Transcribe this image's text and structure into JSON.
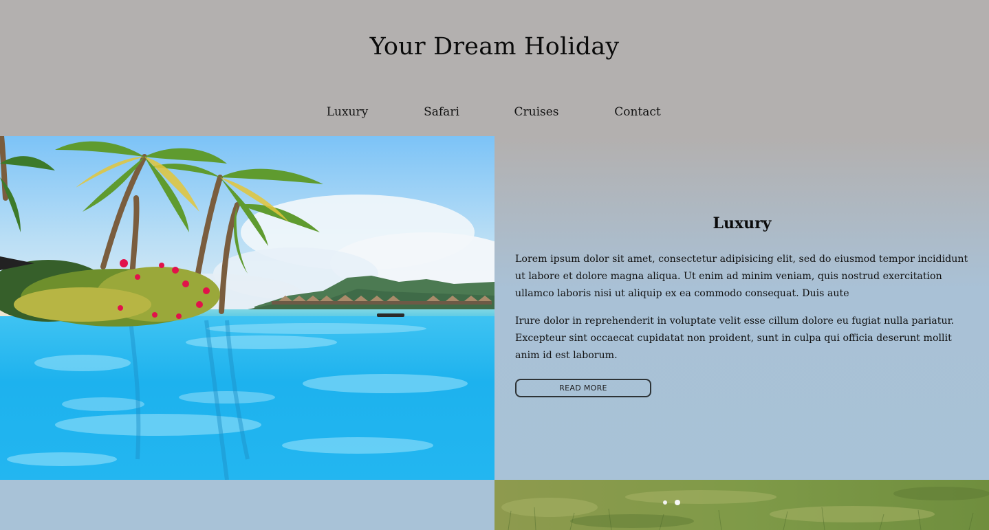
{
  "site": {
    "title": "Your Dream Holiday"
  },
  "nav": {
    "items": [
      {
        "label": "Luxury"
      },
      {
        "label": "Safari"
      },
      {
        "label": "Cruises"
      },
      {
        "label": "Contact"
      }
    ]
  },
  "feature": {
    "heading": "Luxury",
    "paragraphs": [
      "Lorem ipsum dolor sit amet, consectetur adipisicing elit, sed do eiusmod tempor incididunt ut labore et dolore magna aliqua. Ut enim ad minim veniam, quis nostrud exercitation ullamco laboris nisi ut aliquip ex ea commodo consequat. Duis aute",
      "Irure dolor in reprehenderit in voluptate velit esse cillum dolore eu fugiat nulla pariatur. Excepteur sint occaecat cupidatat non proident, sunt in culpa qui officia deserunt mollit anim id est laborum."
    ],
    "button_label": "READ MORE",
    "image_icon": "tropical-pool-photo"
  },
  "second_row": {
    "image_icon": "grassland-photo"
  },
  "colors": {
    "header_bg": "#b3b0af",
    "content_bg": "#a8c2d7",
    "text": "#0a0a0a",
    "button_border": "#2d3336"
  }
}
